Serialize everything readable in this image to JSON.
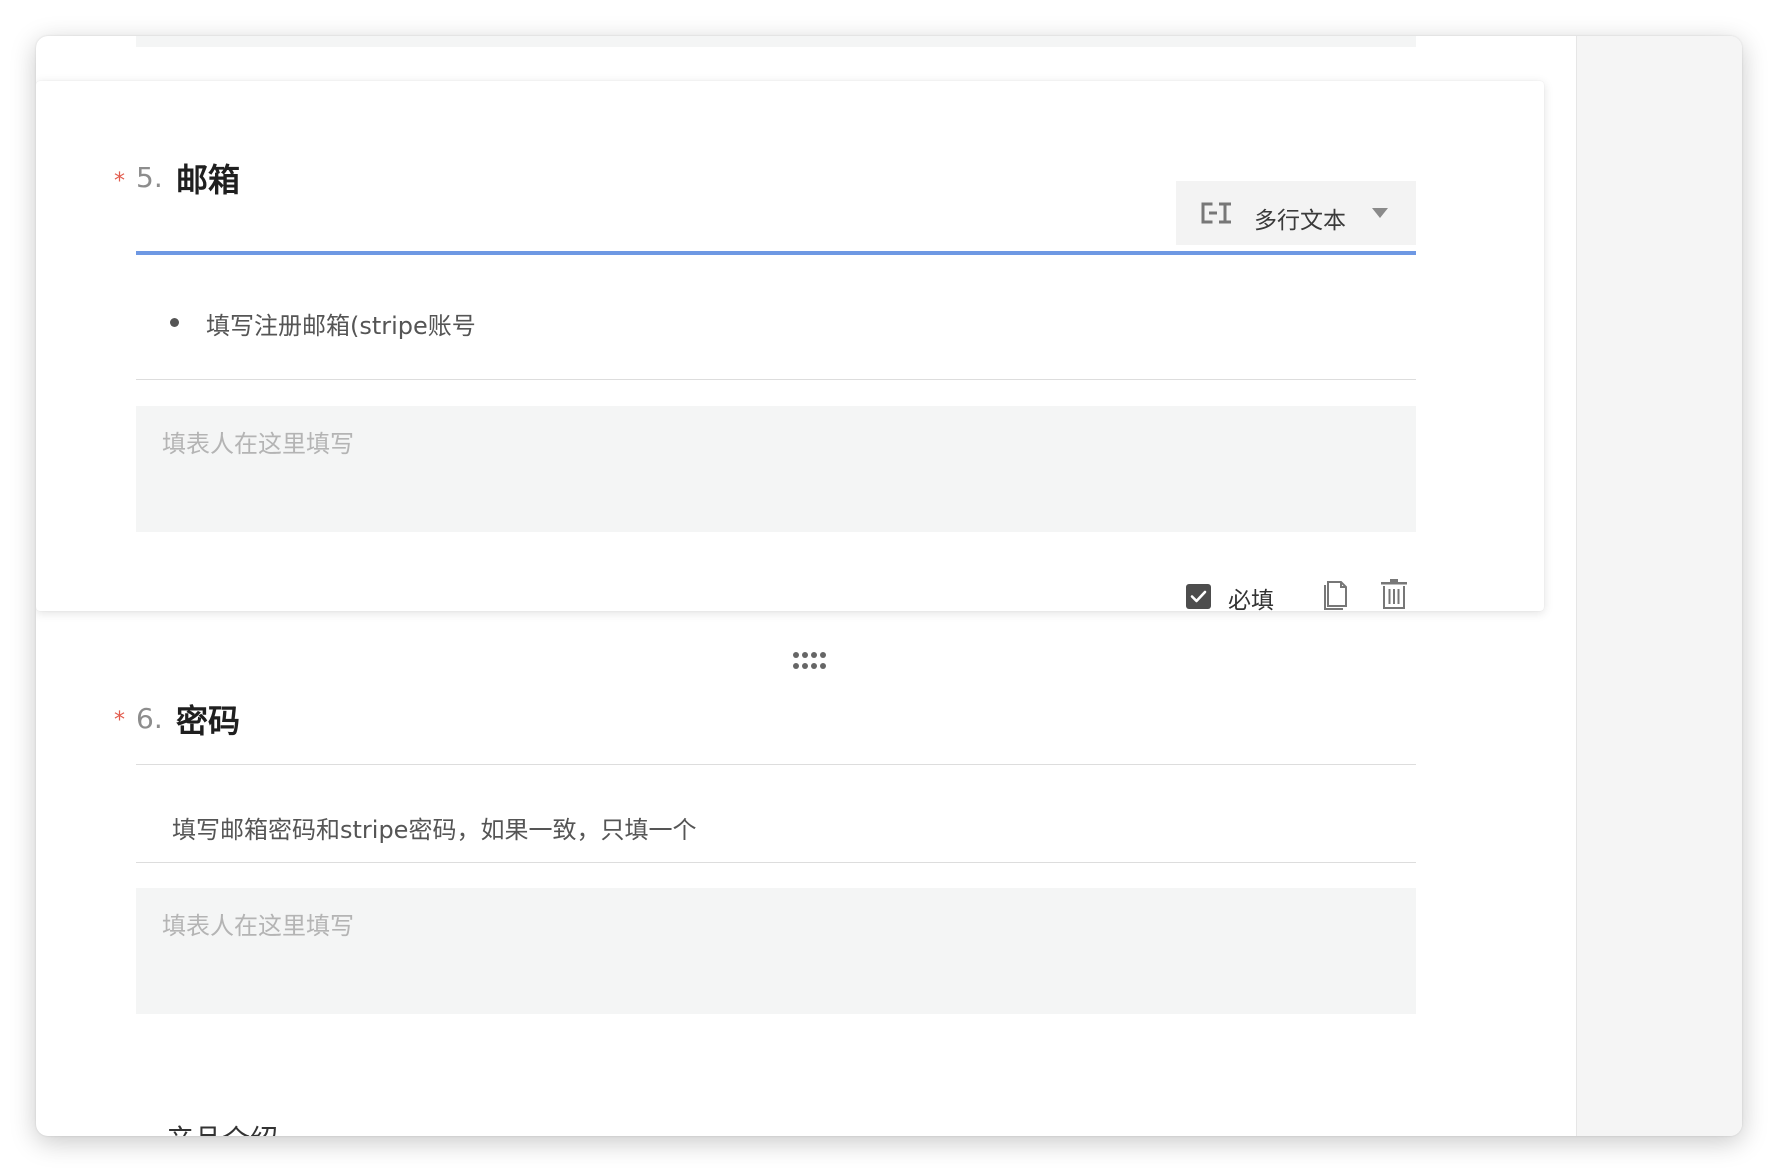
{
  "questions": [
    {
      "required_mark": "*",
      "number": "5.",
      "title": "邮箱",
      "type_selector": {
        "label": "多行文本",
        "icon": "multiline-text-icon"
      },
      "description": "填写注册邮箱(stripe账号",
      "answer_placeholder": "填表人在这里填写",
      "footer": {
        "required_label": "必填",
        "required_checked": true,
        "icons": [
          "copy-icon",
          "delete-icon"
        ]
      }
    },
    {
      "required_mark": "*",
      "number": "6.",
      "title": "密码",
      "description": "填写邮箱密码和stripe密码，如果一致，只填一个",
      "answer_placeholder": "填表人在这里填写"
    }
  ],
  "next_question_peek": "产品介绍",
  "icons": {
    "drag_handle": "drag-handle-icon"
  },
  "colors": {
    "accent_underline": "#6e98e3",
    "required_star": "#e25c4e",
    "answer_box_bg": "#f4f5f5",
    "placeholder_text": "#b4b4b4"
  }
}
